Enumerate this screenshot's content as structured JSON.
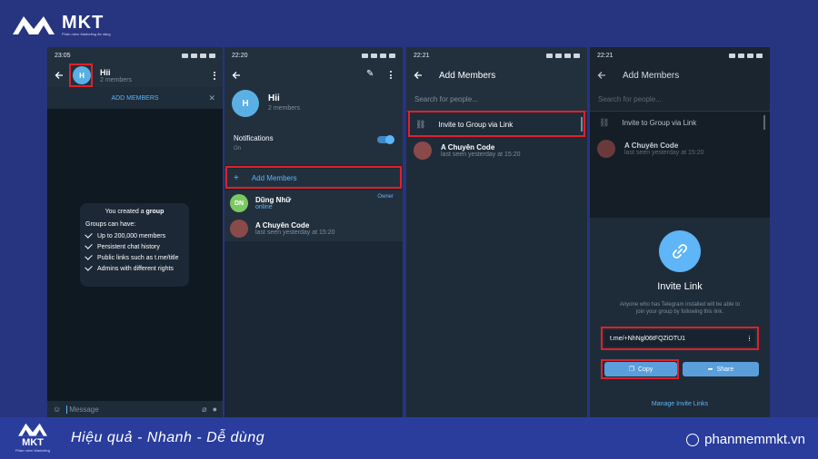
{
  "branding": {
    "logo_text": "MKT",
    "logo_sub": "Phần mềm Marketing đa năng",
    "slogan": "Hiệu quả - Nhanh  - Dễ dùng",
    "website": "phanmemmkt.vn",
    "bottom_logo_text": "MKT",
    "bottom_logo_sub": "Phần mềm Marketing"
  },
  "screen1": {
    "time": "23:05",
    "group_initial": "H",
    "group_name": "Hii",
    "members": "2 members",
    "add_members": "ADD MEMBERS",
    "created_prefix": "You created a ",
    "created_bold": "group",
    "groups_can_have": "Groups can have:",
    "features": [
      "Up to 200,000 members",
      "Persistent chat history",
      "Public links such as t.me/title",
      "Admins with different rights"
    ],
    "message_placeholder": "Message"
  },
  "screen2": {
    "time": "22:20",
    "group_initial": "H",
    "group_name": "Hii",
    "members": "2 members",
    "notifications_label": "Notifications",
    "notifications_state": "On",
    "add_members": "Add Members",
    "member1_initials": "DN",
    "member1_name": "Dũng Nhữ",
    "member1_status": "online",
    "member1_role": "Owner",
    "member2_name": "A Chuyên Code",
    "member2_status": "last seen yesterday at 15:20"
  },
  "screen3": {
    "time": "22:21",
    "title": "Add Members",
    "search_placeholder": "Search for people...",
    "invite_link": "Invite to Group via Link",
    "contact_name": "A Chuyên Code",
    "contact_status": "last seen yesterday at 15:20"
  },
  "screen4": {
    "time": "22:21",
    "title": "Add Members",
    "search_placeholder": "Search for people...",
    "invite_link": "Invite to Group via Link",
    "contact_name": "A Chuyên Code",
    "contact_status": "last seen yesterday at 15:20",
    "sheet_title": "Invite Link",
    "sheet_desc": "Anyone who has Telegram installed will be able to join your group by following this link.",
    "link_value": "t.me/+NhNgl06tFQZiOTU1",
    "copy_label": "Copy",
    "share_label": "Share",
    "manage_links": "Manage Invite Links"
  },
  "colors": {
    "page_bg": "#27347f",
    "phone_bg": "#1e2c3a",
    "accent_blue": "#5eb5f7",
    "highlight_red": "#e0202a",
    "button_blue": "#5a9fdc"
  }
}
